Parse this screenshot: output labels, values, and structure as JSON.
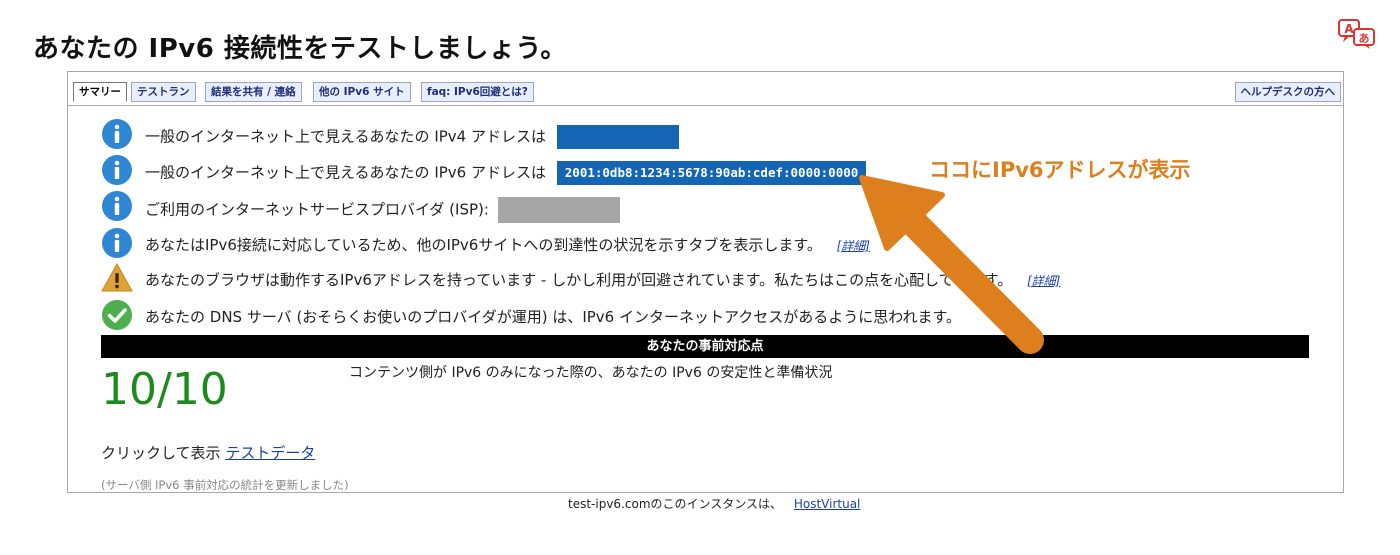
{
  "page": {
    "title": "あなたの IPv6 接続性をテストしましょう。"
  },
  "tabs": [
    {
      "label": "サマリー"
    },
    {
      "label": "テストラン"
    },
    {
      "label": "結果を共有 / 連絡"
    },
    {
      "label": "他の IPv6 サイト"
    },
    {
      "label": "faq: IPv6回避とは?"
    },
    {
      "label": "ヘルプデスクの方へ"
    }
  ],
  "summary": {
    "ipv4_text": "一般のインターネット上で見えるあなたの IPv4 アドレスは",
    "ipv6_text": "一般のインターネット上で見えるあなたの IPv6 アドレスは",
    "ipv6_address": "2001:0db8:1234:5678:90ab:cdef:0000:0000",
    "isp_text": "ご利用のインターネットサービスプロバイダ (ISP):",
    "tabs_text": "あなたはIPv6接続に対応しているため、他のIPv6サイトへの到達性の状況を示すタブを表示します。",
    "browser_text": "あなたのブラウザは動作するIPv6アドレスを持っています - しかし利用が回避されています。私たちはこの点を心配しています。",
    "dns_text": "あなたの DNS サーバ (おそらくお使いのプロバイダが運用) は、IPv6 インターネットアクセスがあるように思われます。",
    "detail_link": "[詳細]"
  },
  "readiness": {
    "bar_title": "あなたの事前対応点",
    "score": "10/10",
    "description": "コンテンツ側が IPv6 のみになった際の、あなたの IPv6 の安定性と準備状況"
  },
  "test_data": {
    "prefix": "クリックして表示",
    "link": "テストデータ"
  },
  "stats_note": "(サーバ側 IPv6 事前対応の統計を更新しました)",
  "footer": {
    "text": "test-ipv6.comのこのインスタンスは、",
    "link": "HostVirtual"
  },
  "annotation": {
    "text": "ココにIPv6アドレスが表示",
    "color": "#dc7f1c"
  },
  "colors": {
    "info_icon": "#2f86d3",
    "warning_icon": "#e2a23a",
    "ok_icon": "#4cae4c",
    "address_box": "#1565b5",
    "score": "#1d8a1d"
  }
}
